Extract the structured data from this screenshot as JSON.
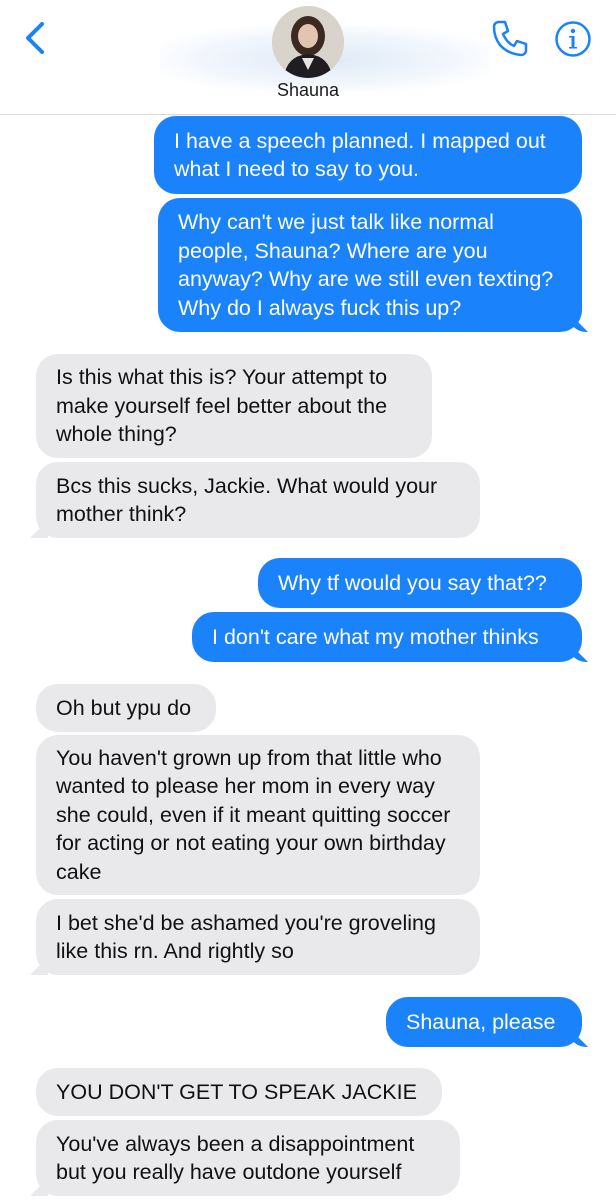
{
  "header": {
    "contact_name": "Shauna",
    "back_icon": "chevron-left-icon",
    "call_icon": "phone-icon",
    "info_icon": "info-icon",
    "accent_color": "#1a82fb"
  },
  "messages": [
    {
      "from": "me",
      "text": "I have a speech planned. I mapped out what I need to say to you."
    },
    {
      "from": "me",
      "text": "Why can't we just talk like normal people, Shauna? Where are you anyway? Why are we still even texting? Why do I always fuck this up?"
    },
    {
      "from": "them",
      "text": "Is this what this is? Your attempt to make yourself feel better about the whole thing?"
    },
    {
      "from": "them",
      "text": "Bcs this sucks, Jackie. What would your mother think?"
    },
    {
      "from": "me",
      "text": "Why tf would you say that??"
    },
    {
      "from": "me",
      "text": "I don't care  what my mother thinks"
    },
    {
      "from": "them",
      "text": "Oh but ypu do"
    },
    {
      "from": "them",
      "text": "You haven't grown up from that little who wanted to please her mom in every way she could, even if it meant quitting soccer for acting or not eating your own birthday cake"
    },
    {
      "from": "them",
      "text": "I bet she'd be ashamed you're groveling like this rn. And rightly so"
    },
    {
      "from": "me",
      "text": "Shauna, please"
    },
    {
      "from": "them",
      "text": "YOU DON'T GET TO SPEAK JACKIE"
    },
    {
      "from": "them",
      "text": "You've always been a disappointment but you really have outdone yourself"
    }
  ]
}
